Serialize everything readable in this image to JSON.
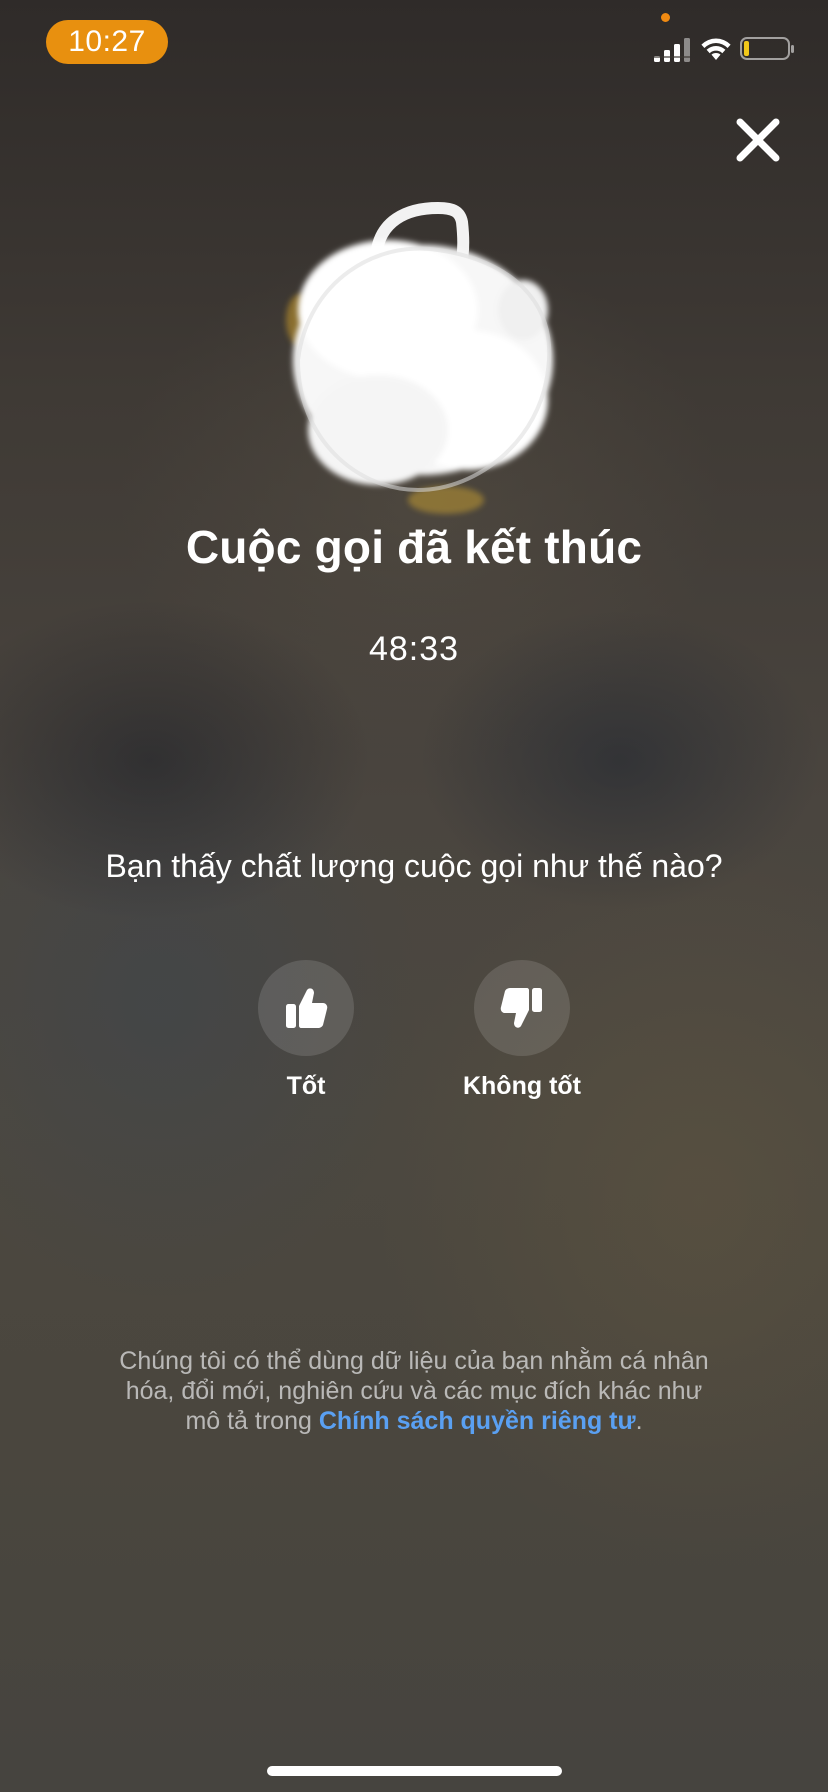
{
  "status_bar": {
    "time": "10:27",
    "icons": {
      "signal": "cellular-signal-icon",
      "wifi": "wifi-icon",
      "battery": "battery-low-icon"
    },
    "time_pill_color": "#e8900f",
    "battery_level_fraction": 0.1
  },
  "close": {
    "icon": "close-icon"
  },
  "call": {
    "title": "Cuộc gọi đã kết thúc",
    "duration": "48:33"
  },
  "rating": {
    "question": "Bạn thấy chất lượng cuộc gọi như thế nào?",
    "options": [
      {
        "label": "Tốt",
        "icon": "thumbs-up-icon"
      },
      {
        "label": "Không tốt",
        "icon": "thumbs-down-icon"
      }
    ]
  },
  "footer": {
    "text_before": "Chúng tôi có thể dùng dữ liệu của bạn nhằm cá nhân hóa, đổi mới, nghiên cứu và các mục đích khác như mô tả trong ",
    "link_text": "Chính sách quyền riêng tư",
    "text_after": ".",
    "link_color": "#5aa0f2"
  }
}
